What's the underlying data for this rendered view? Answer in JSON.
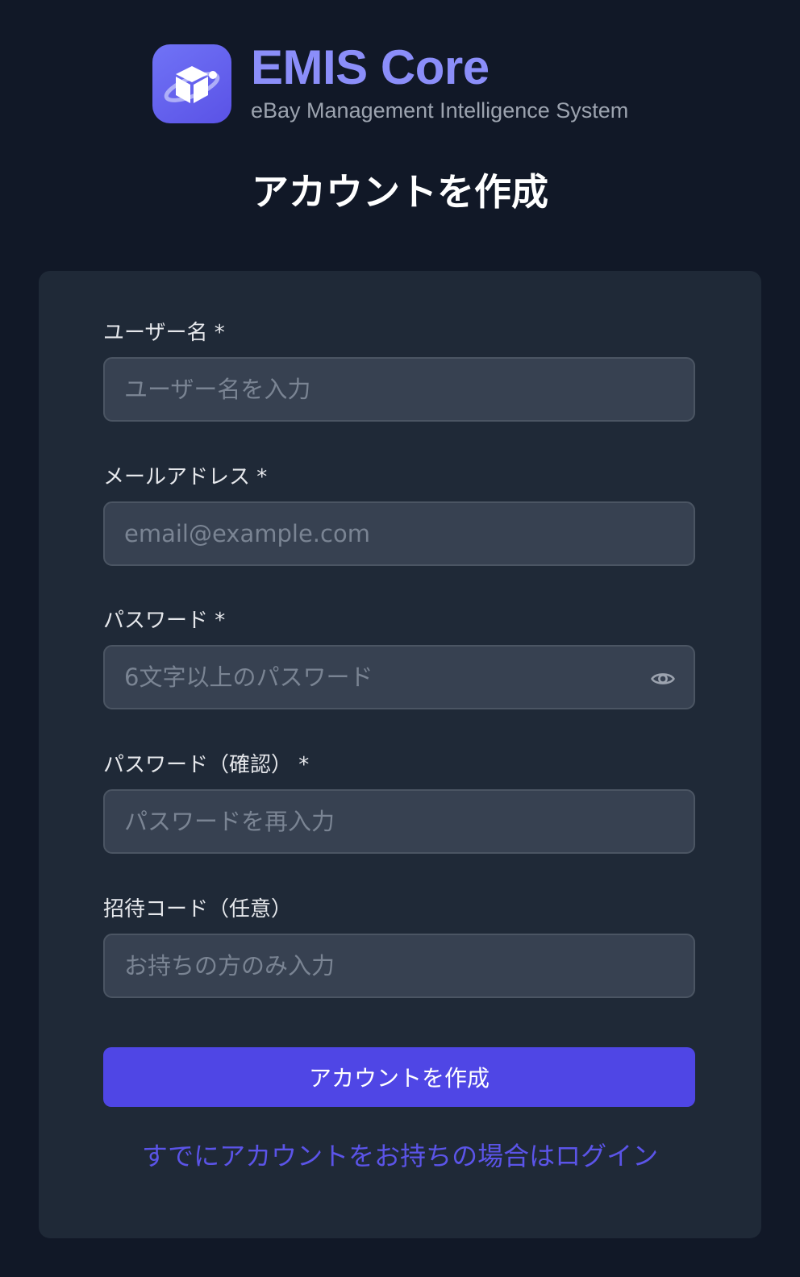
{
  "brand": {
    "title": "EMIS Core",
    "subtitle": "eBay Management Intelligence System",
    "logo_icon": "package-cube-icon",
    "accent_color": "#8b8ef9"
  },
  "page": {
    "title": "アカウントを作成"
  },
  "form": {
    "username": {
      "label": "ユーザー名 *",
      "placeholder": "ユーザー名を入力",
      "value": ""
    },
    "email": {
      "label": "メールアドレス *",
      "placeholder": "email@example.com",
      "value": ""
    },
    "password": {
      "label": "パスワード *",
      "placeholder": "6文字以上のパスワード",
      "value": "",
      "toggle_icon": "eye-icon"
    },
    "password_confirm": {
      "label": "パスワード（確認） *",
      "placeholder": "パスワードを再入力",
      "value": ""
    },
    "invite_code": {
      "label": "招待コード（任意）",
      "placeholder": "お持ちの方のみ入力",
      "value": ""
    },
    "submit_label": "アカウントを作成",
    "login_link": "すでにアカウントをお持ちの場合はログイン"
  },
  "colors": {
    "background": "#111827",
    "card": "#1f2937",
    "input": "#374151",
    "primary_button": "#4f46e5",
    "link": "#5b54e8"
  }
}
